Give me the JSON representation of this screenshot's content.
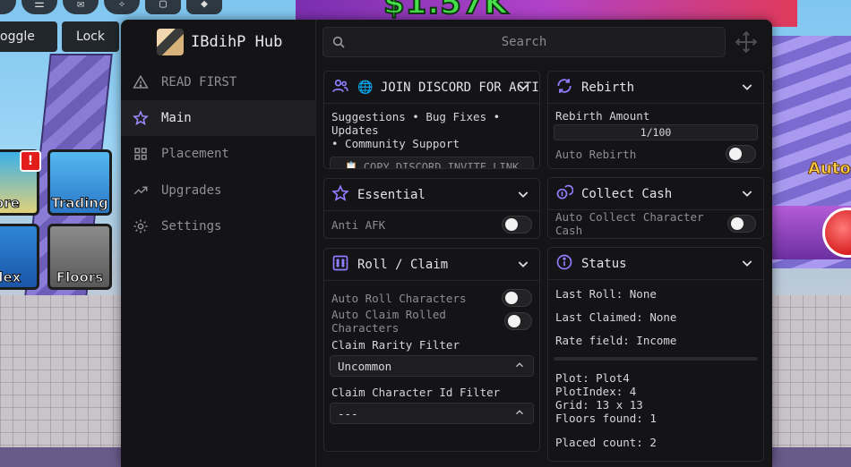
{
  "game": {
    "money": "$1.57K",
    "toggle_label": "oggle",
    "lock_label": "Lock",
    "tiles": {
      "store": "ore",
      "trading": "Trading",
      "index": "dex",
      "floors": "Floors"
    },
    "alert": "!",
    "auto_text": "Auto"
  },
  "hub": {
    "title": "IBdihP Hub",
    "nav": [
      {
        "label": "READ FIRST",
        "icon": "warning-icon"
      },
      {
        "label": "Main",
        "icon": "star-icon"
      },
      {
        "label": "Placement",
        "icon": "grid-icon"
      },
      {
        "label": "Upgrades",
        "icon": "trend-up-icon"
      },
      {
        "label": "Settings",
        "icon": "gear-icon"
      }
    ],
    "search_placeholder": "Search",
    "discord": {
      "title": "🌐 JOIN DISCORD FOR ACTIVE C",
      "line1": "Suggestions • Bug Fixes • Updates",
      "line2": "• Community Support",
      "copy_button": "COPY DISCORD INVITE LINK"
    },
    "essential": {
      "title": "Essential",
      "anti_afk": "Anti AFK"
    },
    "roll": {
      "title": "Roll / Claim",
      "auto_roll": "Auto Roll Characters",
      "auto_claim": "Auto Claim Rolled Characters",
      "rarity_label": "Claim Rarity Filter",
      "rarity_value": "Uncommon",
      "id_label": "Claim Character Id Filter",
      "id_value": "---"
    },
    "rebirth": {
      "title": "Rebirth",
      "amount_label": "Rebirth Amount",
      "amount_value": "1/100",
      "auto_label": "Auto Rebirth"
    },
    "collect": {
      "title": "Collect Cash",
      "auto_label": "Auto Collect Character Cash"
    },
    "status": {
      "title": "Status",
      "last_roll": "Last Roll: None",
      "last_claimed": "Last Claimed: None",
      "rate_field": "Rate field: Income",
      "plot": "Plot: Plot4",
      "plot_index": "PlotIndex: 4",
      "grid": "Grid: 13 x 13",
      "floors_found": "Floors found: 1",
      "placed_count": "Placed count: 2"
    }
  }
}
